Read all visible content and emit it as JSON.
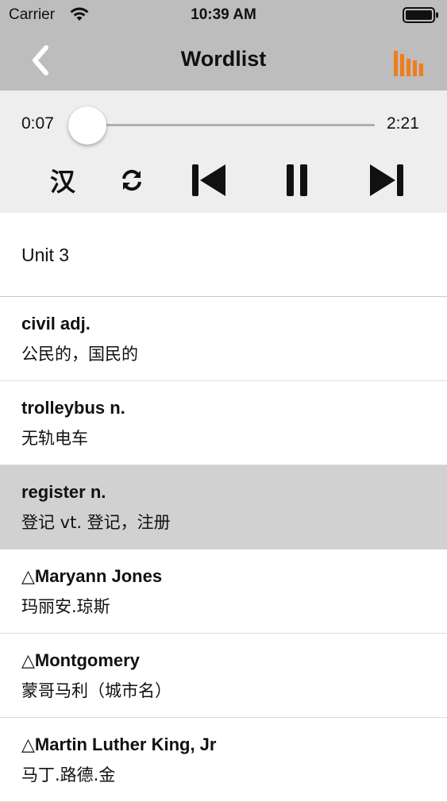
{
  "status_bar": {
    "carrier": "Carrier",
    "time": "10:39 AM",
    "wifi_icon": "wifi-icon",
    "battery_icon": "battery-icon"
  },
  "nav": {
    "title": "Wordlist",
    "back_icon": "chevron-left-icon",
    "stats_icon": "bar-chart-icon",
    "accent_color": "#f07d1a"
  },
  "player": {
    "current_time": "0:07",
    "total_time": "2:21",
    "progress": 0.05,
    "language_toggle_label": "汉",
    "controls": [
      "repeat-icon",
      "previous-track-icon",
      "pause-icon",
      "next-track-icon"
    ],
    "progress_color": "#1a8fe0"
  },
  "list": {
    "section_title": "Unit 3",
    "items": [
      {
        "term": "civil adj.",
        "meaning": "公民的，国民的",
        "selected": false
      },
      {
        "term": "trolleybus n.",
        "meaning": "无轨电车",
        "selected": false
      },
      {
        "term": "register n.",
        "meaning": "登记 vt. 登记，注册",
        "selected": true
      },
      {
        "term": "△Maryann Jones",
        "meaning": "玛丽安.琼斯",
        "selected": false
      },
      {
        "term": "△Montgomery",
        "meaning": "蒙哥马利（城市名）",
        "selected": false
      },
      {
        "term": "△Martin Luther King, Jr",
        "meaning": "马丁.路德.金",
        "selected": false
      }
    ]
  }
}
